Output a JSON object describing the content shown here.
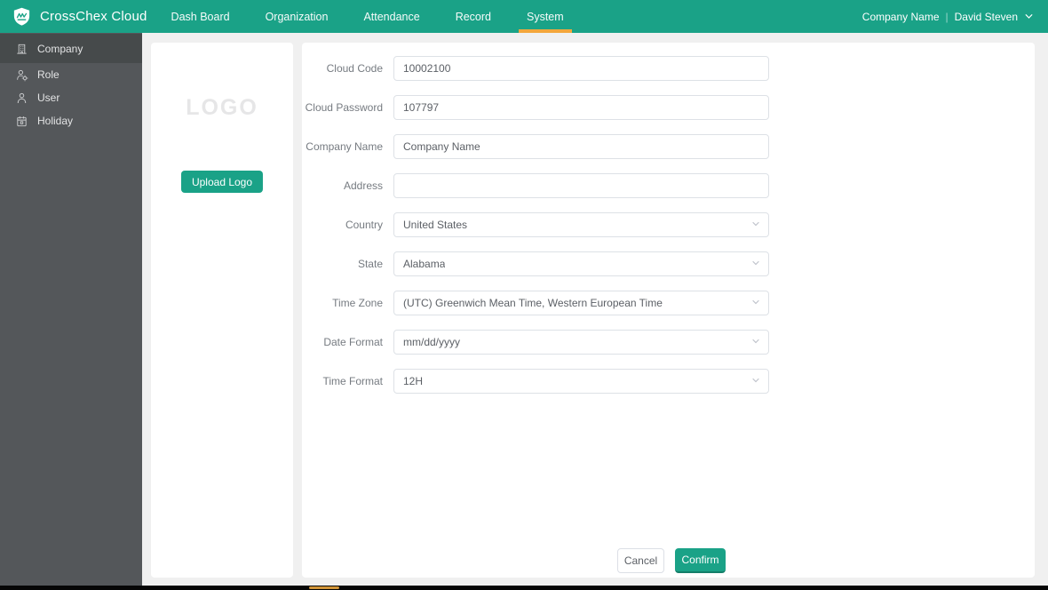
{
  "colors": {
    "accent": "#1aa287",
    "tab-underline": "#f3a73c",
    "sidebar": "#54575a",
    "sidebar-active": "#464a4b",
    "page-bg": "#f0f0f0"
  },
  "header": {
    "brand": "CrossChex Cloud",
    "nav": [
      {
        "label": "Dash Board",
        "active": false
      },
      {
        "label": "Organization",
        "active": false
      },
      {
        "label": "Attendance",
        "active": false
      },
      {
        "label": "Record",
        "active": false
      },
      {
        "label": "System",
        "active": true
      }
    ],
    "company": "Company Name",
    "separator": "|",
    "user": "David Steven"
  },
  "sidebar": {
    "items": [
      {
        "label": "Company",
        "icon": "company-building-icon",
        "active": true
      },
      {
        "label": "Role",
        "icon": "role-person-gear-icon",
        "active": false
      },
      {
        "label": "User",
        "icon": "user-person-icon",
        "active": false
      },
      {
        "label": "Holiday",
        "icon": "holiday-calendar-icon",
        "active": false
      }
    ]
  },
  "logo_panel": {
    "placeholder": "LOGO",
    "upload_label": "Upload Logo"
  },
  "form": {
    "fields": [
      {
        "label": "Cloud Code",
        "value": "10002100",
        "type": "text"
      },
      {
        "label": "Cloud Password",
        "value": "107797",
        "type": "text"
      },
      {
        "label": "Company Name",
        "value": "Company Name",
        "type": "text"
      },
      {
        "label": "Address",
        "value": "",
        "type": "text"
      },
      {
        "label": "Country",
        "value": "United States",
        "type": "select"
      },
      {
        "label": "State",
        "value": "Alabama",
        "type": "select"
      },
      {
        "label": "Time Zone",
        "value": "(UTC) Greenwich Mean Time, Western European Time",
        "type": "select"
      },
      {
        "label": "Date Format",
        "value": "mm/dd/yyyy",
        "type": "select"
      },
      {
        "label": "Time Format",
        "value": "12H",
        "type": "select"
      }
    ],
    "buttons": {
      "cancel": "Cancel",
      "confirm": "Confirm"
    }
  }
}
